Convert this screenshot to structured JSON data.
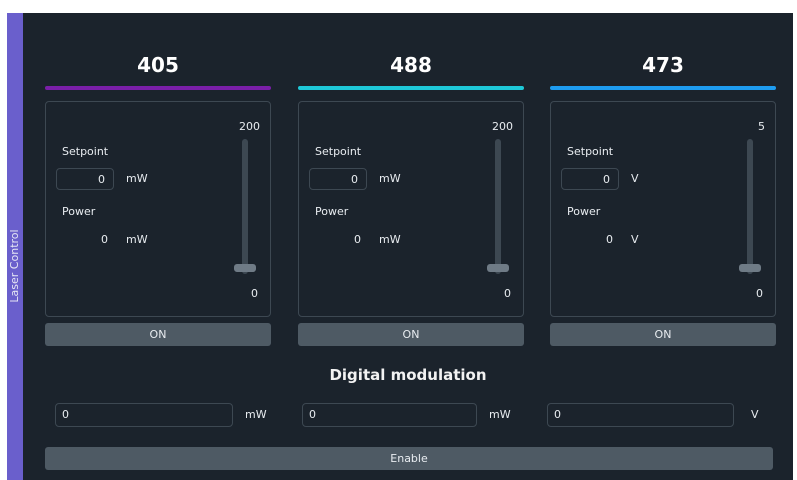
{
  "sidebar": {
    "label": "Laser Control"
  },
  "lasers": [
    {
      "title": "405",
      "color": "#7a1fa8",
      "setpoint_label": "Setpoint",
      "setpoint_value": "0",
      "setpoint_unit": "mW",
      "power_label": "Power",
      "power_value": "0",
      "power_unit": "mW",
      "max": "200",
      "min": "0",
      "slider_level": 0,
      "button_label": "ON"
    },
    {
      "title": "488",
      "color": "#1ec8d8",
      "setpoint_label": "Setpoint",
      "setpoint_value": "0",
      "setpoint_unit": "mW",
      "power_label": "Power",
      "power_value": "0",
      "power_unit": "mW",
      "max": "200",
      "min": "0",
      "slider_level": 0,
      "button_label": "ON"
    },
    {
      "title": "473",
      "color": "#1e9cf0",
      "setpoint_label": "Setpoint",
      "setpoint_value": "0",
      "setpoint_unit": "V",
      "power_label": "Power",
      "power_value": "0",
      "power_unit": "V",
      "max": "5",
      "min": "0",
      "slider_level": 0,
      "button_label": "ON"
    }
  ],
  "modulation": {
    "title": "Digital modulation",
    "inputs": [
      {
        "value": "0",
        "unit": "mW"
      },
      {
        "value": "0",
        "unit": "mW"
      },
      {
        "value": "0",
        "unit": "V"
      }
    ],
    "enable_label": "Enable"
  }
}
